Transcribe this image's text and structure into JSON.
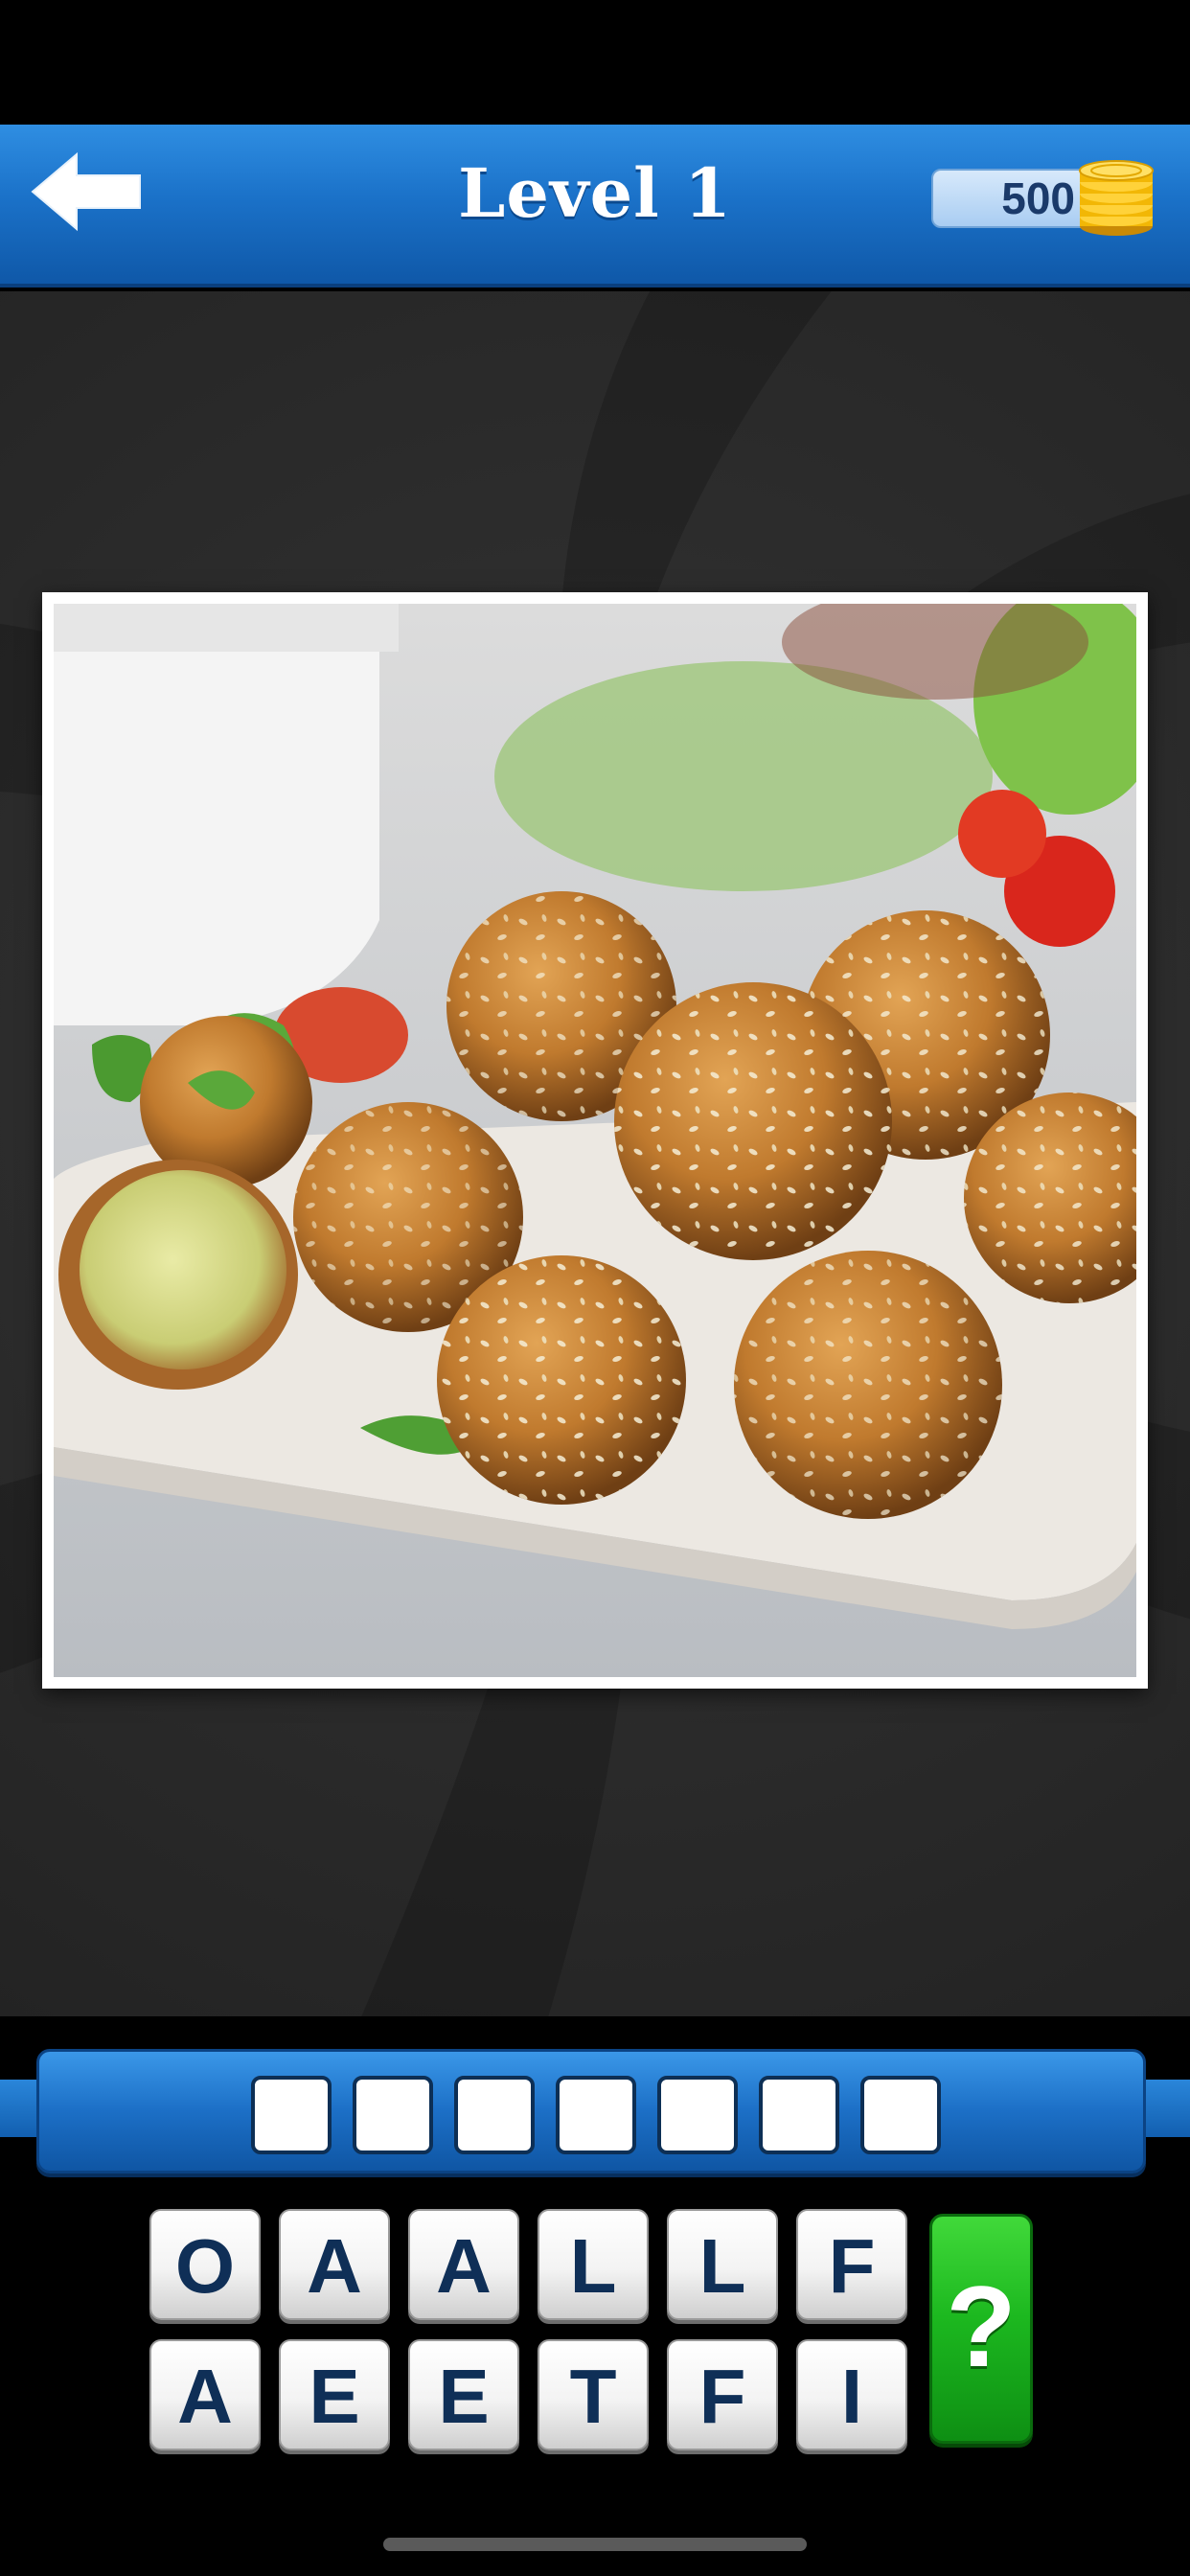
{
  "header": {
    "back_icon": "arrow-left-icon",
    "title": "Level 1",
    "coins": "500",
    "coin_icon": "coin-stack-icon",
    "colors": {
      "bar": "#1b72c9",
      "title": "#ffffff"
    }
  },
  "puzzle": {
    "image_subject_icon": "falafel-photo",
    "answer_length": 7,
    "slots": [
      "",
      "",
      "",
      "",
      "",
      "",
      ""
    ],
    "letters_row1": [
      "O",
      "A",
      "A",
      "L",
      "L",
      "F"
    ],
    "letters_row2": [
      "A",
      "E",
      "E",
      "T",
      "F",
      "I"
    ],
    "hint_label": "?",
    "colors": {
      "tile_text": "#0f2f57",
      "hint": "#1cb81f"
    }
  }
}
